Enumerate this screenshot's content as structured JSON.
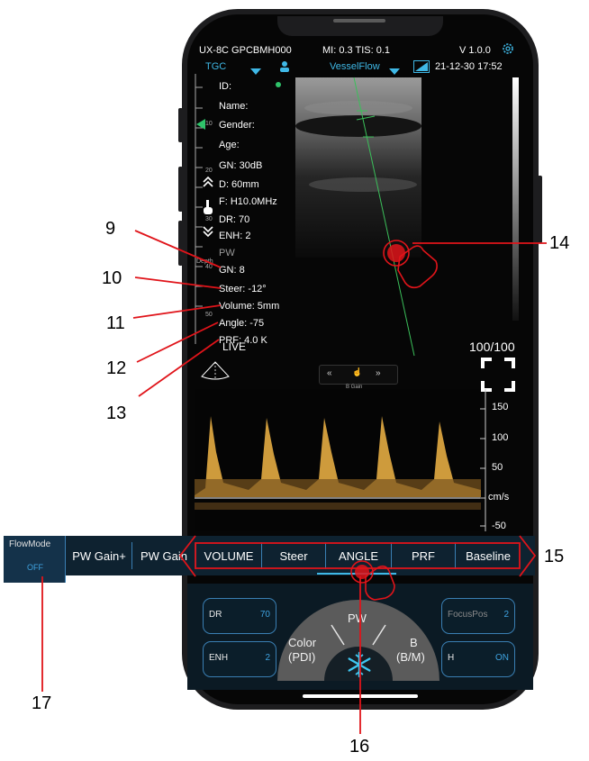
{
  "status_bar": {
    "device": "UX-8C GPCBMH000",
    "mi_tis": "MI: 0.3  TIS: 0.1",
    "version": "V 1.0.0",
    "tgc": "TGC",
    "mode": "VesselFlow",
    "datetime": "21-12-30 17:52"
  },
  "patient": {
    "id": "ID:",
    "name": "Name:",
    "gender": "Gender:",
    "age": "Age:"
  },
  "params": {
    "gn": "GN: 30dB",
    "depth": "D: 60mm",
    "freq": "F: H10.0MHz",
    "dr": "DR: 70",
    "enh": "ENH: 2",
    "pw": "PW",
    "pw_gn": "GN: 8",
    "steer": "Steer: -12°",
    "volume": "Volume: 5mm",
    "angle": "Angle: -75",
    "prf": "PRF: 4.0 K"
  },
  "depth_ruler": {
    "label": "Depth",
    "ticks": [
      "10",
      "20",
      "30",
      "40",
      "50"
    ]
  },
  "live": "LIVE",
  "gain_control": "B Gain",
  "gain_value": "100/100",
  "velocity_scale": {
    "ticks": [
      "150",
      "100",
      "50",
      "cm/s",
      "-50"
    ]
  },
  "flowmode": {
    "label": "FlowMode",
    "value": "OFF"
  },
  "tabs": [
    "PW Gain+",
    "PW Gain",
    "VOLUME",
    "Steer",
    "ANGLE",
    "PRF",
    "Baseline"
  ],
  "active_tab": "ANGLE",
  "bottom_buttons": {
    "dr_label": "DR",
    "dr_value": "70",
    "enh_label": "ENH",
    "enh_value": "2",
    "focus_label": "FocusPos",
    "focus_value": "2",
    "h_label": "H",
    "h_value": "ON"
  },
  "mode_dial": {
    "pw": "PW",
    "color": "Color",
    "color_sub": "(PDI)",
    "b": "B",
    "b_sub": "(B/M)"
  },
  "annotations": [
    "9",
    "10",
    "11",
    "12",
    "13",
    "14",
    "15",
    "16",
    "17"
  ],
  "colors": {
    "accent": "#3fb8e6",
    "annotation_line": "#e0141a",
    "doppler": "#e8b04a",
    "button_border": "#3a7fb3"
  },
  "icons": [
    "gear-icon",
    "dropdown-triangle-icon",
    "person-icon",
    "mode-toggle-icon",
    "fullscreen-icon",
    "snowflake-icon",
    "hand-tap-icon",
    "probe-fan-icon",
    "chevron-up-icon",
    "chevron-down-icon"
  ]
}
